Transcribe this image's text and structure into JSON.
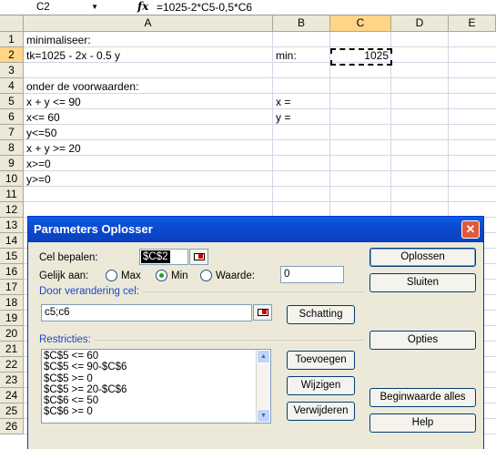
{
  "formula_bar": {
    "name_box": "C2",
    "fx": "fx",
    "formula": "=1025-2*C5-0,5*C6"
  },
  "columns": [
    "A",
    "B",
    "C",
    "D",
    "E"
  ],
  "rows": [
    "1",
    "2",
    "3",
    "4",
    "5",
    "6",
    "7",
    "8",
    "9",
    "10",
    "11",
    "12",
    "13",
    "14",
    "15",
    "16",
    "17",
    "18",
    "19",
    "20",
    "21",
    "22",
    "23",
    "24",
    "25",
    "26"
  ],
  "cells": {
    "A1": "minimaliseer:",
    "A2": "tk=1025 - 2x - 0.5 y",
    "B2": "min:",
    "C2": "1025",
    "A4": "onder de voorwaarden:",
    "A5": "x + y <= 90",
    "B5": "x =",
    "A6": "x<= 60",
    "B6": "y =",
    "A7": "y<=50",
    "A8": "x + y >= 20",
    "A9": "x>=0",
    "A10": "y>=0"
  },
  "dialog": {
    "title": "Parameters Oplosser",
    "close": "✕",
    "target_label": "Cel bepalen:",
    "target_value": "$C$2",
    "equal_to_label": "Gelijk aan:",
    "opt_max": "Max",
    "opt_min": "Min",
    "opt_value": "Waarde:",
    "selected_option": "Min",
    "value_field": "0",
    "changing_label": "Door verandering cel:",
    "changing_value": "c5;c6",
    "guess_button": "Schatting",
    "constraints_label": "Restricties:",
    "constraints": [
      "$C$5 <= 60",
      "$C$5 <= 90-$C$6",
      "$C$5 >= 0",
      "$C$5 >= 20-$C$6",
      "$C$6 <= 50",
      "$C$6 >= 0"
    ],
    "add_button": "Toevoegen",
    "change_button": "Wijzigen",
    "delete_button": "Verwijderen",
    "solve_button": "Oplossen",
    "close_button": "Sluiten",
    "options_button": "Opties",
    "reset_button": "Beginwaarde alles",
    "help_button": "Help"
  }
}
